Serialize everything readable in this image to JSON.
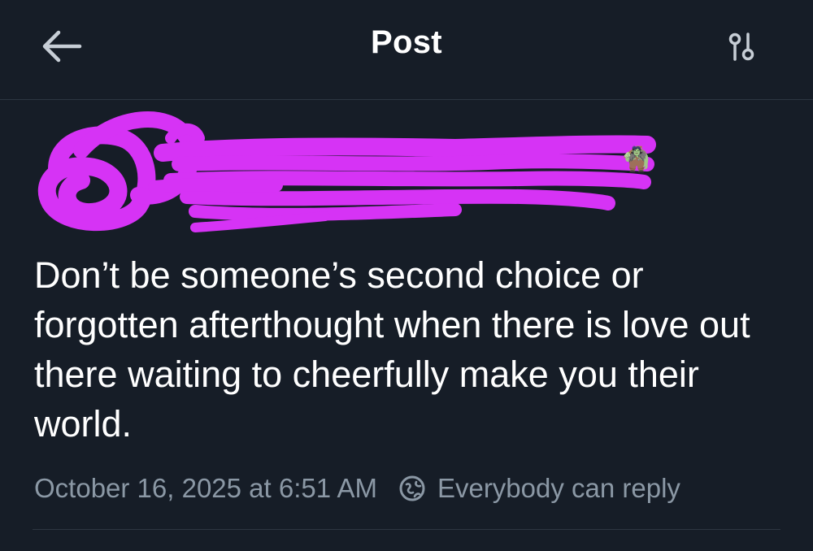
{
  "header": {
    "title": "Post",
    "back_icon": "arrow-left-icon",
    "settings_icon": "sliders-icon"
  },
  "author": {
    "redaction_color": "#d633f5",
    "emoji": "🧌"
  },
  "post": {
    "text": "Don’t be someone’s second choice or forgotten afterthought when there is love out there waiting to cheerfully make you their world.",
    "timestamp": "October 16, 2025 at 6:51 AM",
    "reply_setting": "Everybody can reply",
    "reply_icon": "globe-icon"
  },
  "colors": {
    "background": "#161d27",
    "text": "#ffffff",
    "muted": "#8b98a5",
    "divider": "#2d3641"
  }
}
